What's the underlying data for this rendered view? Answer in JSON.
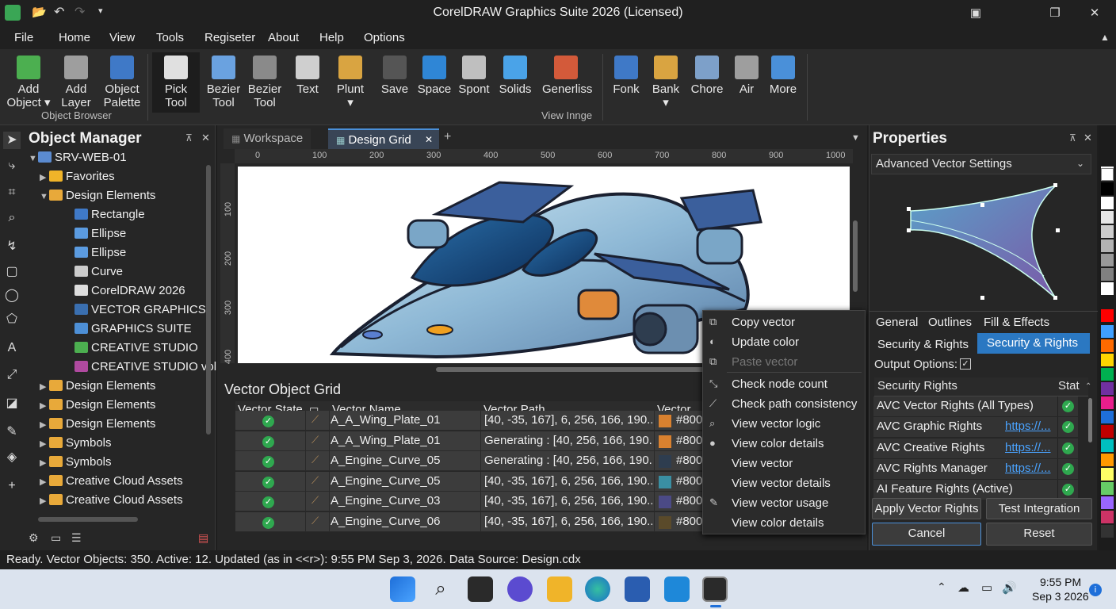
{
  "window": {
    "title": "CorelDRAW Graphics Suite 2026 (Licensed)"
  },
  "menu": [
    "File",
    "Home",
    "View",
    "Tools",
    "Regiseter",
    "About",
    "Help",
    "Options"
  ],
  "ribbon": {
    "buttons": [
      {
        "l1": "Add",
        "l2": "Object ▾",
        "color": "#4caf50"
      },
      {
        "l1": "Add",
        "l2": "Layer",
        "color": "#9e9e9e"
      },
      {
        "l1": "Object",
        "l2": "Palette",
        "color": "#3f79c7"
      },
      {
        "l1": "Pick",
        "l2": "Tool",
        "color": "#e0e0e0"
      },
      {
        "l1": "Bezier",
        "l2": "Tool",
        "color": "#6aa2e0"
      },
      {
        "l1": "Bezier",
        "l2": "Tool",
        "color": "#8a8a8a"
      },
      {
        "l1": "Text",
        "l2": "",
        "color": "#cfcfcf"
      },
      {
        "l1": "Plunt",
        "l2": "▾",
        "color": "#d9a441"
      },
      {
        "l1": "Save",
        "l2": "",
        "color": "#555555"
      },
      {
        "l1": "Space",
        "l2": "",
        "color": "#2f86d6"
      },
      {
        "l1": "Spont",
        "l2": "",
        "color": "#bfbfbf"
      },
      {
        "l1": "Solids",
        "l2": "",
        "color": "#4aa3e8"
      },
      {
        "l1": "Generliss",
        "l2": "",
        "color": "#d35a3a"
      },
      {
        "l1": "Fonk",
        "l2": "",
        "color": "#3f79c7"
      },
      {
        "l1": "Bank",
        "l2": "▾",
        "color": "#d9a441"
      },
      {
        "l1": "Chore",
        "l2": "",
        "color": "#7da0c9"
      },
      {
        "l1": "Air",
        "l2": "",
        "color": "#9e9e9e"
      },
      {
        "l1": "More",
        "l2": "",
        "color": "#4a90d9"
      }
    ],
    "group1": "Object Browser",
    "group2": "View Innge"
  },
  "objmgr": {
    "title": "Object Manager",
    "items": [
      {
        "t": "SRV-WEB-01",
        "lvl": 0,
        "exp": "▼",
        "ic": "#5b8bd0"
      },
      {
        "t": "Favorites",
        "lvl": 1,
        "exp": "▶",
        "ic": "#f0b429"
      },
      {
        "t": "Design Elements",
        "lvl": 1,
        "exp": "▼",
        "ic": "#e8a93a"
      },
      {
        "t": "Rectangle",
        "lvl": 2,
        "exp": "",
        "ic": "#3f79c7"
      },
      {
        "t": "Ellipse",
        "lvl": 2,
        "exp": "",
        "ic": "#5b9be0"
      },
      {
        "t": "Ellipse",
        "lvl": 2,
        "exp": "",
        "ic": "#5b9be0"
      },
      {
        "t": "Curve",
        "lvl": 2,
        "exp": "",
        "ic": "#cccccc"
      },
      {
        "t": "CorelDRAW 2026",
        "lvl": 2,
        "exp": "",
        "ic": "#dddddd"
      },
      {
        "t": "VECTOR GRAPHICS",
        "lvl": 2,
        "exp": "",
        "ic": "#3a6fb0"
      },
      {
        "t": "GRAPHICS SUITE",
        "lvl": 2,
        "exp": "",
        "ic": "#4d8fd6"
      },
      {
        "t": "CREATIVE STUDIO",
        "lvl": 2,
        "exp": "",
        "ic": "#4caf50"
      },
      {
        "t": "CREATIVE STUDIO vol.",
        "lvl": 2,
        "exp": "",
        "ic": "#b04aa0"
      },
      {
        "t": "Design Elements",
        "lvl": 1,
        "exp": "▶",
        "ic": "#e8a93a"
      },
      {
        "t": "Design Elements",
        "lvl": 1,
        "exp": "▶",
        "ic": "#e8a93a"
      },
      {
        "t": "Design Elements",
        "lvl": 1,
        "exp": "▶",
        "ic": "#e8a93a"
      },
      {
        "t": "Symbols",
        "lvl": 1,
        "exp": "▶",
        "ic": "#e8a93a"
      },
      {
        "t": "Symbols",
        "lvl": 1,
        "exp": "▶",
        "ic": "#e8a93a"
      },
      {
        "t": "Creative Cloud Assets",
        "lvl": 1,
        "exp": "▶",
        "ic": "#e8a93a"
      },
      {
        "t": "Creative Cloud Assets",
        "lvl": 1,
        "exp": "▶",
        "ic": "#e8a93a"
      }
    ]
  },
  "tabs": {
    "workspace": "Workspace",
    "design": "Design Grid",
    "close": "✕",
    "add": "+"
  },
  "ruler": [
    "0",
    "100",
    "200",
    "300",
    "400",
    "500",
    "600",
    "700",
    "800",
    "900",
    "1000"
  ],
  "vruler": [
    "100",
    "200",
    "300",
    "400"
  ],
  "grid": {
    "title": "Vector Object Grid",
    "headers": [
      "Vector State",
      "Vector Name",
      "Vector Path",
      "Vector Co"
    ],
    "rows": [
      {
        "name": "A_A_Wing_Plate_01",
        "path": "[40, -35, 167], 6, 256, 166, 190...",
        "col": "#800",
        "sw": "#d9812f"
      },
      {
        "name": "A_A_Wing_Plate_01",
        "path": "Generating : [40, 256, 166, 190...",
        "col": "#800",
        "sw": "#d9812f"
      },
      {
        "name": "A_Engine_Curve_05",
        "path": "Generating : [40, 256, 166, 190...",
        "col": "#800",
        "sw": "#2e3d4f"
      },
      {
        "name": "A_Engine_Curve_05",
        "path": "[40, -35, 167], 6, 256, 166, 190...",
        "col": "#800",
        "sw": "#3a8fa3"
      },
      {
        "name": "A_Engine_Curve_03",
        "path": "[40, -35, 167], 6, 256, 166, 190...",
        "col": "#800",
        "sw": "#4b4a86"
      },
      {
        "name": "A_Engine_Curve_06",
        "path": "[40, -35, 167], 6, 256, 166, 190...",
        "col": "#800",
        "sw": "#5a4a2a"
      }
    ]
  },
  "context": [
    {
      "t": "Copy vector",
      "ic": "⧉",
      "dis": false
    },
    {
      "t": "Update color",
      "ic": "◐",
      "dis": false
    },
    {
      "t": "Paste vector",
      "ic": "⧉",
      "dis": true
    },
    {
      "t": "Check node count",
      "ic": "⤡",
      "dis": false
    },
    {
      "t": "Check path consistency",
      "ic": "⟋",
      "dis": false
    },
    {
      "t": "View vector logic",
      "ic": "⌕",
      "dis": false
    },
    {
      "t": "View color details",
      "ic": "●",
      "dis": false
    },
    {
      "t": "View vector",
      "ic": "",
      "dis": false
    },
    {
      "t": "View vector details",
      "ic": "",
      "dis": false
    },
    {
      "t": "View vector usage",
      "ic": "✎",
      "dis": false
    },
    {
      "t": "View color details",
      "ic": "",
      "dis": false
    }
  ],
  "props": {
    "title": "Properties",
    "dropdown": "Advanced Vector Settings",
    "tabs": [
      "General",
      "Outlines",
      "Fill & Effects"
    ],
    "tabs2": [
      "Security & Rights",
      "Security & Rights"
    ],
    "output": "Output Options:",
    "table_h": [
      "Security Rights",
      "Stat"
    ],
    "rows": [
      {
        "t": "AVC Vector Rights (All Types)",
        "link": ""
      },
      {
        "t": "AVC Graphic Rights",
        "link": "https://..."
      },
      {
        "t": "AVC Creative Rights",
        "link": "https://..."
      },
      {
        "t": "AVC Rights Manager",
        "link": "https://..."
      },
      {
        "t": "AI Feature Rights (Active)",
        "link": ""
      }
    ],
    "btn_apply": "Apply Vector Rights",
    "btn_test": "Test Integration",
    "btn_cancel": "Cancel",
    "btn_reset": "Reset"
  },
  "palette": [
    "#ffffff",
    "#000000",
    "#ffffff",
    "#e6e6e6",
    "#cccccc",
    "#b3b3b3",
    "#999999",
    "#808080",
    "#ffffff",
    "#ff0000",
    "#3fa0ff",
    "#ff6a00",
    "#ffd400",
    "#00b050",
    "#7030a0",
    "#e91e8c",
    "#1e6fd9",
    "#c00000",
    "#00c0c0",
    "#ff9900",
    "#ffff66",
    "#66cc66",
    "#9966ff",
    "#cc3366",
    "#333333"
  ],
  "status": "Ready. Vector Objects: 350. Active: 12. Updated (as in <<r>): 9:55 PM Sep 3, 2026. Data Source: Design.cdx",
  "taskbar": {
    "time": "9:55 PM",
    "date": "Sep 3 2026"
  }
}
